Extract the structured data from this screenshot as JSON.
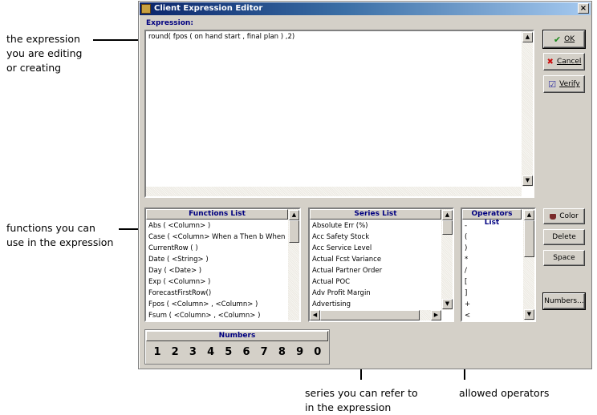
{
  "annotations": {
    "expression": "the expression\nyou are editing\nor creating",
    "functions": "functions you can\nuse in the expression",
    "series": "series you can refer to\nin the expression",
    "operators": "allowed operators"
  },
  "window": {
    "title": "Client Expression Editor",
    "close": "×"
  },
  "expression": {
    "label": "Expression:",
    "value": "round( fpos (  on hand start ,  final plan ) ,2)"
  },
  "buttons": {
    "ok": "OK",
    "cancel": "Cancel",
    "verify": "Verify",
    "color": "Color",
    "delete": "Delete",
    "space": "Space",
    "numbers": "Numbers..."
  },
  "functions_list": {
    "header": "Functions List",
    "items": [
      "Abs ( <Column> )",
      "Case ( <Column> When a Then b When c Then d Else e )",
      "CurrentRow ( )",
      "Date ( <String> )",
      "Day ( <Date> )",
      "Exp ( <Column> )",
      "ForecastFirstRow()",
      "Fpos ( <Column> , <Column> )",
      "Fsum ( <Column> , <Column> )"
    ]
  },
  "series_list": {
    "header": "Series List",
    "items": [
      "Absolute Err (%)",
      "Acc Safety Stock",
      "Acc Service Level",
      "Actual Fcst Variance",
      "Actual Partner Order",
      "Actual POC",
      "Adv Profit Margin",
      "Advertising"
    ]
  },
  "operators_list": {
    "header": "Operators List",
    "items": [
      "-",
      "(",
      ")",
      "*",
      "/",
      "[",
      "]",
      "+",
      "<"
    ]
  },
  "numbers": {
    "header": "Numbers",
    "digits": [
      "1",
      "2",
      "3",
      "4",
      "5",
      "6",
      "7",
      "8",
      "9",
      "0"
    ]
  },
  "icons": {
    "up": "▲",
    "down": "▼",
    "left": "◀",
    "right": "▶",
    "ok": "✔",
    "cancel": "✖",
    "verify": "☑"
  },
  "colors": {
    "title_start": "#0a246a",
    "title_end": "#a6caf0",
    "panel": "#d4d0c8",
    "header_text": "#000080"
  }
}
